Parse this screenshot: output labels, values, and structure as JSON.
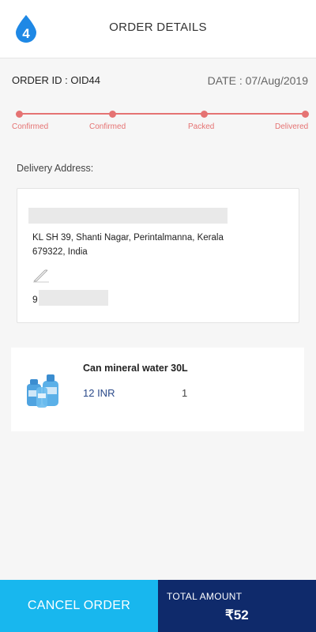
{
  "header": {
    "title": "ORDER DETAILS",
    "logo_text": "4",
    "logo_icon": "water-drop-icon"
  },
  "order": {
    "id_text": "ORDER ID : OID44",
    "date_text": "DATE : 07/Aug/2019"
  },
  "tracker": {
    "steps": [
      "Confirmed",
      "Confirmed",
      "Packed",
      "Delivered"
    ],
    "color": "#e57373"
  },
  "delivery": {
    "label": "Delivery Address:",
    "address_line1": "KL SH 39, Shanti Nagar, Perintalmanna, Kerala",
    "address_line2": "679322, India",
    "phone_prefix": "9",
    "edit_icon": "edit-pencil-icon"
  },
  "item": {
    "name": "Can mineral water 30L",
    "price": "12 INR",
    "quantity": "1",
    "thumb_icon": "water-can-icon"
  },
  "footer": {
    "cancel_label": "CANCEL ORDER",
    "total_label": "TOTAL AMOUNT",
    "total_value": "₹52",
    "cancel_color": "#18b7ee",
    "total_color": "#0f2a6b"
  }
}
